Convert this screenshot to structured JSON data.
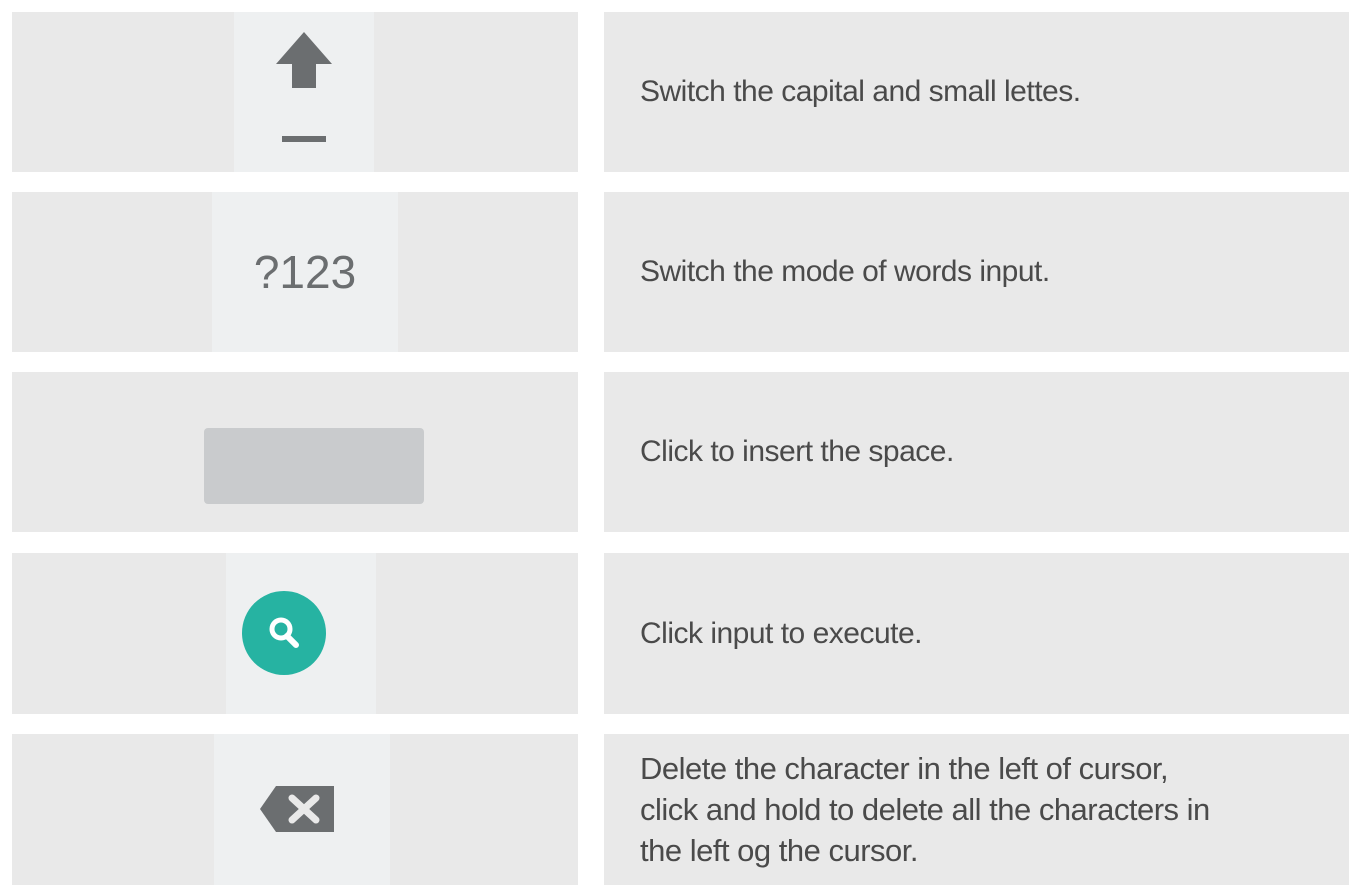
{
  "rows": [
    {
      "icon": "shift-arrow-icon",
      "description": "Switch the capital and small lettes."
    },
    {
      "icon": "numeric-mode-key",
      "key_label": "?123",
      "description": "Switch the mode of words input."
    },
    {
      "icon": "space-bar-key",
      "description": "Click to insert the space."
    },
    {
      "icon": "search-icon",
      "description": "Click input to execute."
    },
    {
      "icon": "backspace-icon",
      "description_lines": [
        "Delete the character in the left of cursor,",
        "click and hold to delete all the characters in",
        "the left og the cursor."
      ]
    }
  ],
  "colors": {
    "cell_background": "#e9e9e9",
    "key_gray": "#6b6e70",
    "search_accent": "#26b3a2",
    "text": "#4a4a4a"
  }
}
